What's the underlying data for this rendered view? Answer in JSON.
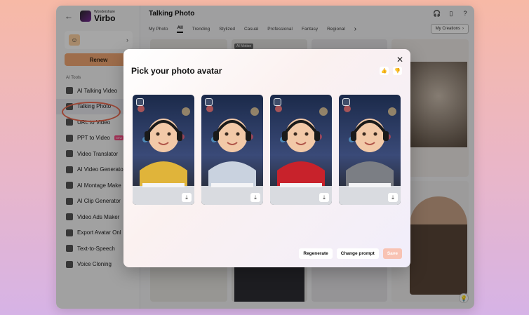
{
  "app": {
    "brand_small": "Wondershare",
    "brand_big": "Virbo"
  },
  "sidebar": {
    "renew_label": "Renew",
    "section_label": "AI Tools",
    "items": [
      {
        "label": "AI Talking Video",
        "icon": "ai-talking-video-icon"
      },
      {
        "label": "Talking Photo",
        "icon": "talking-photo-icon",
        "active": true
      },
      {
        "label": "URL to Video",
        "icon": "url-to-video-icon"
      },
      {
        "label": "PPT to Video",
        "icon": "ppt-to-video-icon",
        "badge": "NEW"
      },
      {
        "label": "Video Translator",
        "icon": "video-translator-icon"
      },
      {
        "label": "AI Video Generato",
        "icon": "ai-video-generator-icon"
      },
      {
        "label": "AI Montage Make",
        "icon": "ai-montage-maker-icon"
      },
      {
        "label": "AI Clip Generator",
        "icon": "ai-clip-generator-icon"
      },
      {
        "label": "Video Ads Maker",
        "icon": "video-ads-maker-icon"
      },
      {
        "label": "Export Avatar Onl",
        "icon": "export-avatar-icon"
      },
      {
        "label": "Text-to-Speech",
        "icon": "text-to-speech-icon"
      },
      {
        "label": "Voice Cloning",
        "icon": "voice-cloning-icon"
      }
    ]
  },
  "main": {
    "title": "Talking Photo",
    "tabs": [
      "My Photo",
      "All",
      "Trending",
      "Stylized",
      "Casual",
      "Professional",
      "Fantasy",
      "Regional"
    ],
    "active_tab": "All",
    "my_creations_label": "My Creations",
    "grid_badge": "AI Motion"
  },
  "modal": {
    "title": "Pick your photo avatar",
    "regenerate_label": "Regenerate",
    "change_prompt_label": "Change prompt",
    "save_label": "Save",
    "cards": [
      {
        "shirt_color": "#e0b43a"
      },
      {
        "shirt_color": "#c9d2df"
      },
      {
        "shirt_color": "#c8222b"
      },
      {
        "shirt_color": "#7b7e84"
      }
    ]
  },
  "colors": {
    "accent": "#f3a873",
    "highlight_ring": "#f06a50",
    "save_disabled": "#f8c3b4"
  }
}
